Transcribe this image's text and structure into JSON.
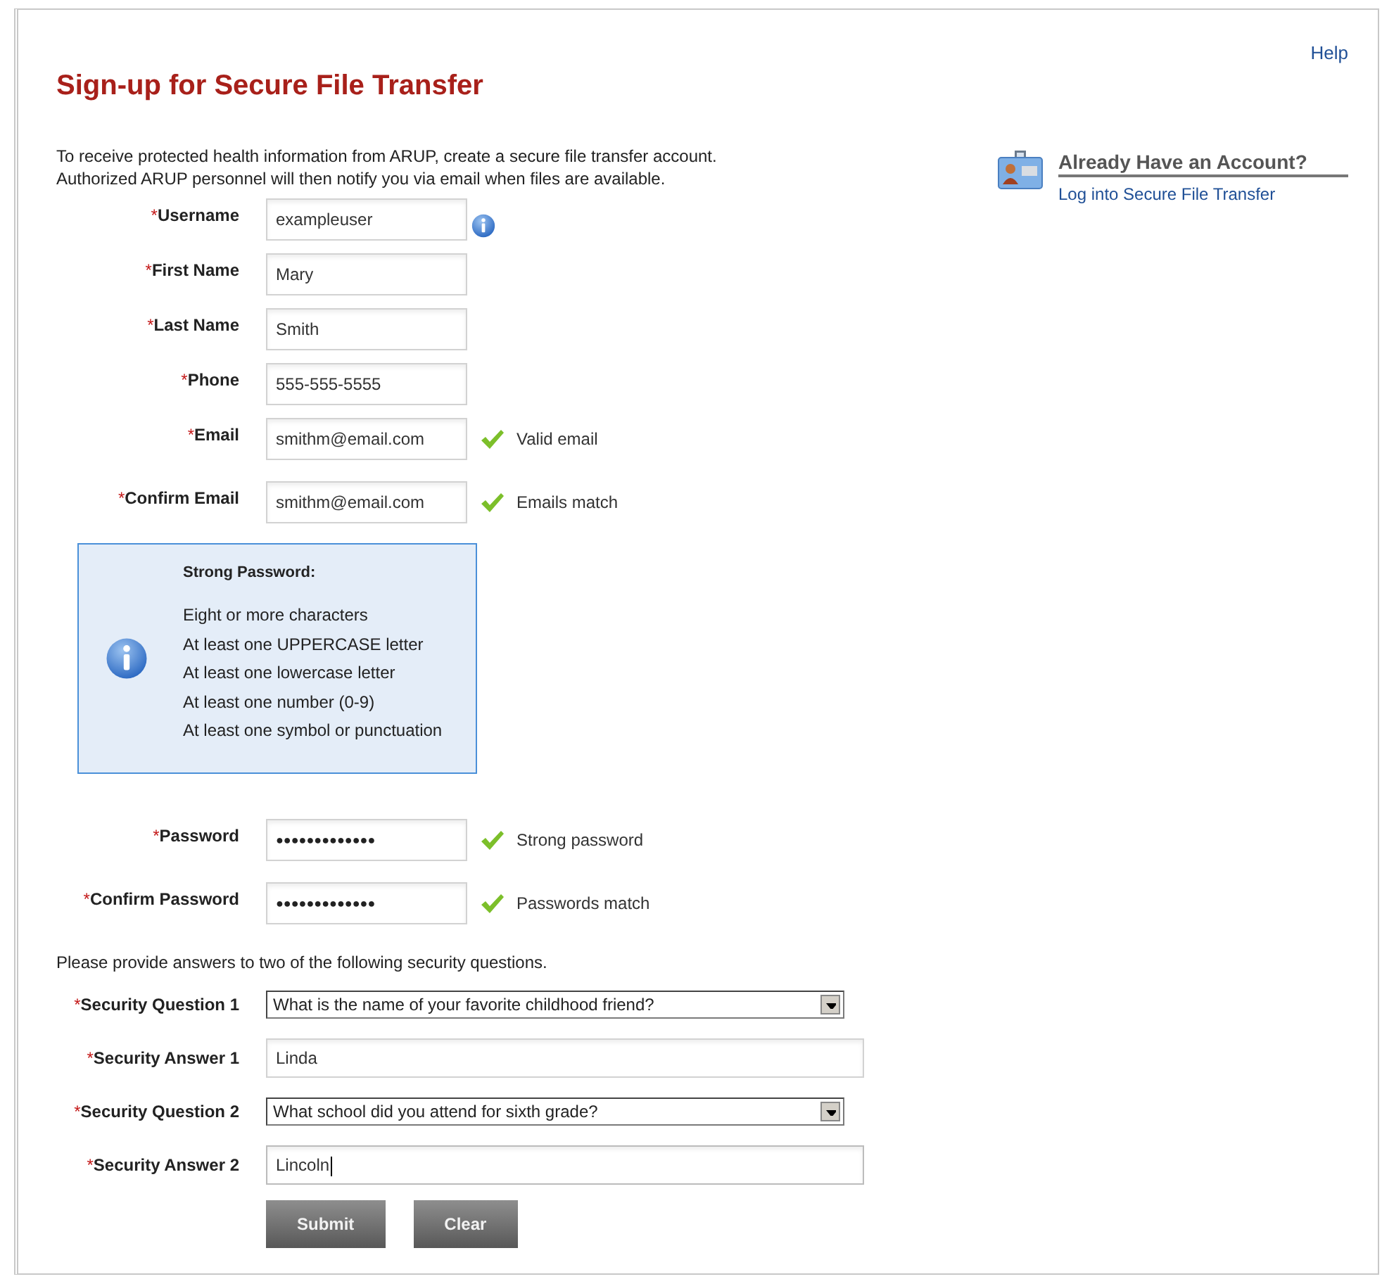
{
  "help_link": "Help",
  "title": "Sign-up for Secure File Transfer",
  "intro": [
    "To receive protected health information from ARUP, create a secure file transfer account.",
    "Authorized ARUP personnel will then notify you via email when files are available."
  ],
  "account_panel": {
    "heading": "Already Have an Account?",
    "link": "Log into Secure File Transfer"
  },
  "account_fields": [
    {
      "kind": "text",
      "required_mark": "*",
      "label": "Username",
      "value": "exampleuser",
      "info": true
    },
    {
      "kind": "text",
      "required_mark": "*",
      "label": "First Name",
      "value": "Mary"
    },
    {
      "kind": "text",
      "required_mark": "*",
      "label": "Last Name",
      "value": "Smith"
    },
    {
      "kind": "text",
      "required_mark": "*",
      "label": "Phone",
      "value": "555-555-5555"
    },
    {
      "kind": "text",
      "required_mark": "*",
      "label": "Email",
      "value": "smithm@email.com",
      "validation": {
        "valid": true,
        "message": "Valid email"
      }
    },
    {
      "kind": "text",
      "required_mark": "*",
      "label": "Confirm Email",
      "value": "smithm@email.com",
      "validation": {
        "valid": true,
        "message": "Emails match"
      }
    }
  ],
  "password_tips": {
    "heading": "Strong Password:",
    "items": [
      "Eight or more characters",
      "At least one UPPERCASE letter",
      "At least one lowercase letter",
      "At least one number (0-9)",
      "At least one symbol or punctuation"
    ]
  },
  "password_fields": [
    {
      "kind": "password",
      "required_mark": "*",
      "label": "Password",
      "value": "●●●●●●●●●●●●●",
      "validation": {
        "valid": true,
        "message": "Strong password"
      }
    },
    {
      "kind": "password",
      "required_mark": "*",
      "label": "Confirm Password",
      "value": "●●●●●●●●●●●●●",
      "validation": {
        "valid": true,
        "message": "Passwords match"
      }
    }
  ],
  "security_prompt": "Please provide answers to two of the following security questions.",
  "security_fields": [
    {
      "kind": "select",
      "required_mark": "*",
      "label": "Security Question 1",
      "value": "What is the name of your favorite childhood friend?"
    },
    {
      "kind": "text",
      "required_mark": "*",
      "label": "Security Answer 1",
      "value": "Linda",
      "focused": false
    },
    {
      "kind": "select",
      "required_mark": "*",
      "label": "Security Question 2",
      "value": "What school did you attend for sixth grade?"
    },
    {
      "kind": "text",
      "required_mark": "*",
      "label": "Security Answer 2",
      "value": "Lincoln",
      "focused": true
    }
  ],
  "buttons": [
    {
      "label": "Submit"
    },
    {
      "label": "Clear"
    }
  ]
}
